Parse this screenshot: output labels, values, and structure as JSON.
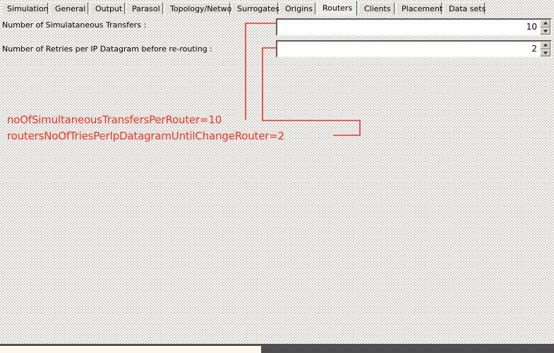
{
  "window": {
    "title": "Routers"
  },
  "tabs": {
    "items": [
      {
        "label": "Simulation",
        "active": false
      },
      {
        "label": "General",
        "active": false
      },
      {
        "label": "Output",
        "active": false
      },
      {
        "label": "Parasol",
        "active": false
      },
      {
        "label": "Topology/Network",
        "active": false
      },
      {
        "label": "Surrogates",
        "active": false
      },
      {
        "label": "Origins",
        "active": false
      },
      {
        "label": "Routers",
        "active": true
      },
      {
        "label": "Clients",
        "active": false
      },
      {
        "label": "Placement",
        "active": false
      },
      {
        "label": "Data sets",
        "active": false
      }
    ]
  },
  "form": {
    "fields": [
      {
        "label": "Number of Simulataneous Transfers :",
        "value": "10",
        "placeholder": "",
        "spinner_up_icon": "triangle-up-icon",
        "spinner_down_icon": "triangle-down-icon"
      },
      {
        "label": "Number of Retries per IP Datagram before re-routing :",
        "value": "2",
        "placeholder": "",
        "spinner_up_icon": "triangle-up-icon",
        "spinner_down_icon": "triangle-down-icon"
      }
    ]
  },
  "annotations": {
    "color": "#e8342a",
    "items": [
      {
        "text": "noOfSimultaneousTransfersPerRouter=10"
      },
      {
        "text": "routersNoOfTriesPerIpDatagramUntilChangeRouter=2"
      }
    ]
  },
  "colors": {
    "background": "#d4d0c8",
    "field_background": "#ffffff",
    "annotation_red": "#e8342a",
    "border_dark": "#5e5e5e",
    "border_light": "#f4f3ef",
    "bottom_bar": "#4f4f4f"
  }
}
